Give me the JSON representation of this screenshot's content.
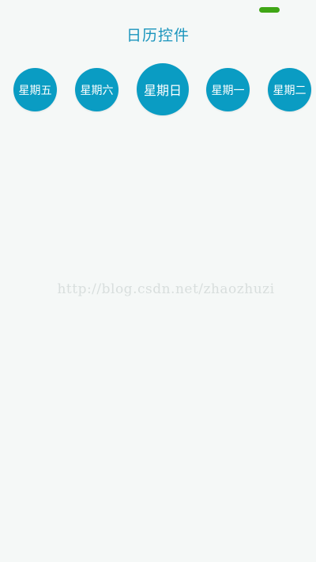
{
  "app": {
    "title": "日历控件"
  },
  "calendar": {
    "days": [
      {
        "label": "星期五",
        "selected": false
      },
      {
        "label": "星期六",
        "selected": false
      },
      {
        "label": "星期日",
        "selected": true
      },
      {
        "label": "星期一",
        "selected": false
      },
      {
        "label": "星期二",
        "selected": false
      }
    ]
  },
  "watermark": {
    "text": "http://blog.csdn.net/zhaozhuzi"
  },
  "colors": {
    "accent": "#0a9cc3",
    "title": "#1a95bd",
    "status_indicator": "#3fa615",
    "background": "#f5f8f7"
  }
}
